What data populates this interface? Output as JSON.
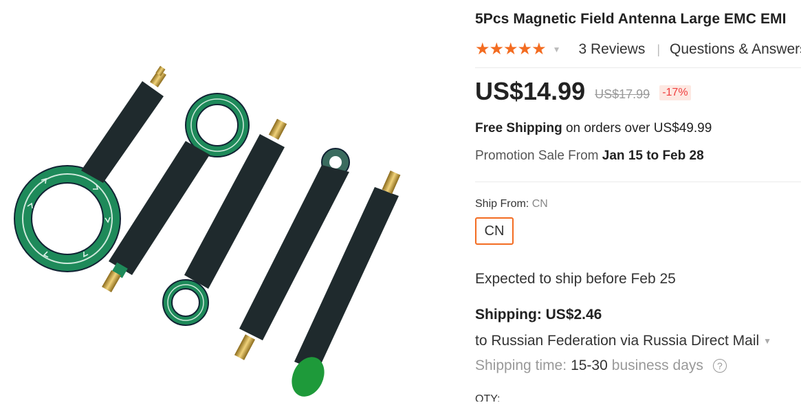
{
  "product": {
    "title": "5Pcs Magnetic Field Antenna Large EMC EMI",
    "image_alt": "Five magnetic field probe antennas with green PCB loops and SMA connectors"
  },
  "rating": {
    "stars": "★★★★★",
    "reviews": "3 Reviews",
    "separator": "|",
    "questions": "Questions & Answers"
  },
  "price": {
    "current": "US$14.99",
    "original": "US$17.99",
    "discount": "-17%"
  },
  "free_shipping": {
    "label": "Free Shipping",
    "text": "on orders over US$49.99"
  },
  "promotion": {
    "prefix": "Promotion Sale From",
    "dates": "Jan 15 to Feb 28"
  },
  "ship_from": {
    "label": "Ship From:",
    "value": "CN",
    "option": "CN"
  },
  "expected": "Expected to ship before Feb 25",
  "shipping": {
    "label": "Shipping: US$2.46",
    "destination": "to Russian Federation via Russia Direct Mail",
    "time_label": "Shipping time:",
    "time_value": "15-30",
    "time_unit": "business days"
  },
  "qty_label": "QTY:",
  "colors": {
    "accent": "#f36c21",
    "discount_bg": "#fde8e2",
    "pcb_green": "#1e8a5a",
    "probe_body": "#1f2a2d"
  }
}
